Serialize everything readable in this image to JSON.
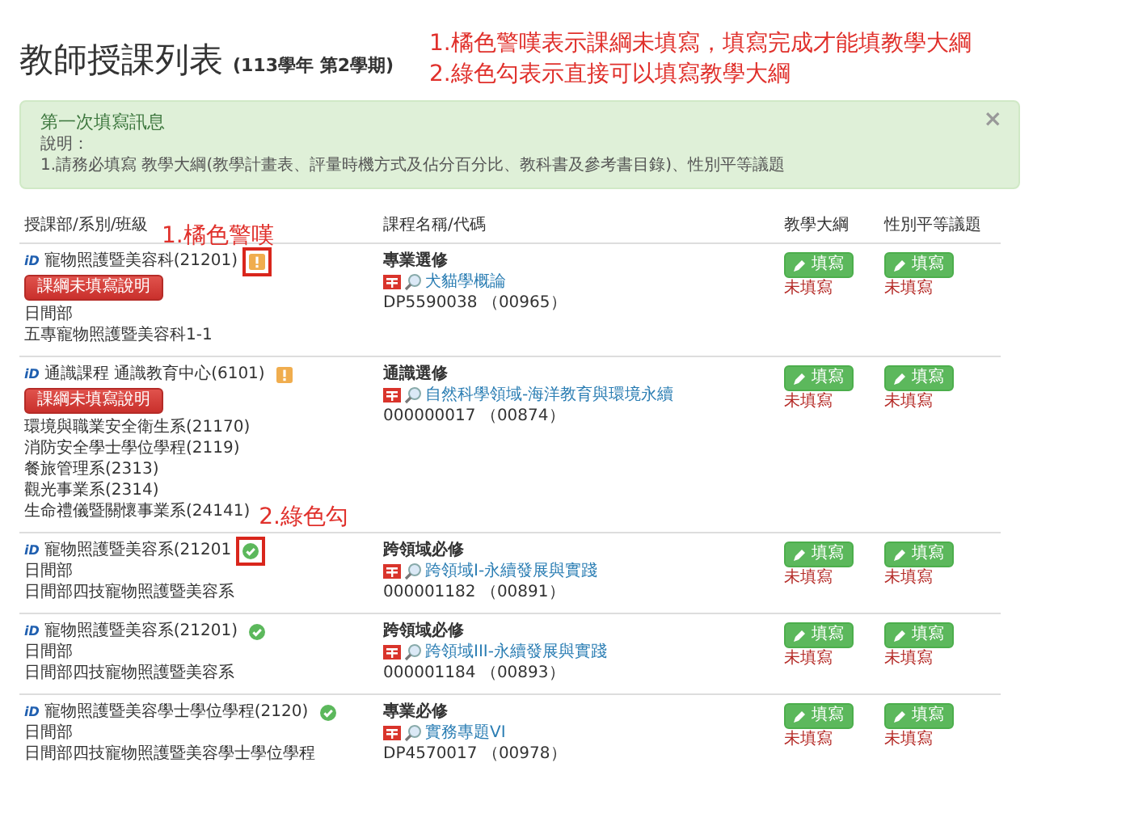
{
  "header": {
    "title": "教師授課列表",
    "term": "(113學年 第2學期)"
  },
  "notes": [
    "1.橘色警嘆表示課綱未填寫，填寫完成才能填教學大綱",
    "2.綠色勾表示直接可以填寫教學大綱"
  ],
  "alert": {
    "title": "第一次填寫訊息",
    "close": "×",
    "lines": [
      "說明：",
      "1.請務必填寫 教學大綱(教學計畫表、評量時機方式及佔分百分比、教科書及參考書目錄)、性別平等議題"
    ]
  },
  "table": {
    "columns": [
      "授課部/系別/班級",
      "課程名稱/代碼",
      "教學大綱",
      "性別平等議題"
    ],
    "rows": [
      {
        "tag": "iD",
        "unit": "寵物照護暨美容科(21201)",
        "kind": "warning",
        "highlighted": true,
        "callout": "1.橘色警嘆",
        "button": "課綱未填寫說明",
        "details": [
          "日間部",
          "五專寵物照護暨美容科1-1"
        ],
        "course_type": "專業選修",
        "course_name": "犬貓學概論",
        "course_code": "DP5590038 （00965）",
        "syllabus": {
          "button": "填寫",
          "state": "未填寫"
        },
        "gender": {
          "button": "填寫",
          "state": "未填寫"
        }
      },
      {
        "tag": "iD",
        "unit": "通識課程 通識教育中心(6101)",
        "kind": "warning",
        "highlighted": false,
        "button": "課綱未填寫說明",
        "details": [
          "環境與職業安全衛生系(21170)",
          "消防安全學士學位學程(2119)",
          "餐旅管理系(2313)",
          "觀光事業系(2314)",
          "生命禮儀暨關懷事業系(24141)"
        ],
        "course_type": "通識選修",
        "course_name": "自然科學領域-海洋教育與環境永續",
        "course_code": "000000017 （00874）",
        "syllabus": {
          "button": "填寫",
          "state": "未填寫"
        },
        "gender": {
          "button": "填寫",
          "state": "未填寫"
        }
      },
      {
        "tag": "iD",
        "unit": "寵物照護暨美容系(21201",
        "kind": "ok",
        "highlighted": true,
        "callout": "2.綠色勾",
        "details": [
          "日間部",
          "日間部四技寵物照護暨美容系"
        ],
        "course_type": "跨領域必修",
        "course_name": "跨領域I-永續發展與實踐",
        "course_code": "000001182 （00891）",
        "syllabus": {
          "button": "填寫",
          "state": "未填寫"
        },
        "gender": {
          "button": "填寫",
          "state": "未填寫"
        }
      },
      {
        "tag": "iD",
        "unit": "寵物照護暨美容系(21201)",
        "kind": "ok",
        "highlighted": false,
        "details": [
          "日間部",
          "日間部四技寵物照護暨美容系"
        ],
        "course_type": "跨領域必修",
        "course_name": "跨領域III-永續發展與實踐",
        "course_code": "000001184 （00893）",
        "syllabus": {
          "button": "填寫",
          "state": "未填寫"
        },
        "gender": {
          "button": "填寫",
          "state": "未填寫"
        }
      },
      {
        "tag": "iD",
        "unit": "寵物照護暨美容學士學位學程(2120)",
        "kind": "ok",
        "highlighted": false,
        "details": [
          "日間部",
          "日間部四技寵物照護暨美容學士學位學程"
        ],
        "course_type": "專業必修",
        "course_name": "實務專題VI",
        "course_code": "DP4570017 （00978）",
        "syllabus": {
          "button": "填寫",
          "state": "未填寫"
        },
        "gender": {
          "button": "填寫",
          "state": "未填寫"
        }
      }
    ]
  }
}
